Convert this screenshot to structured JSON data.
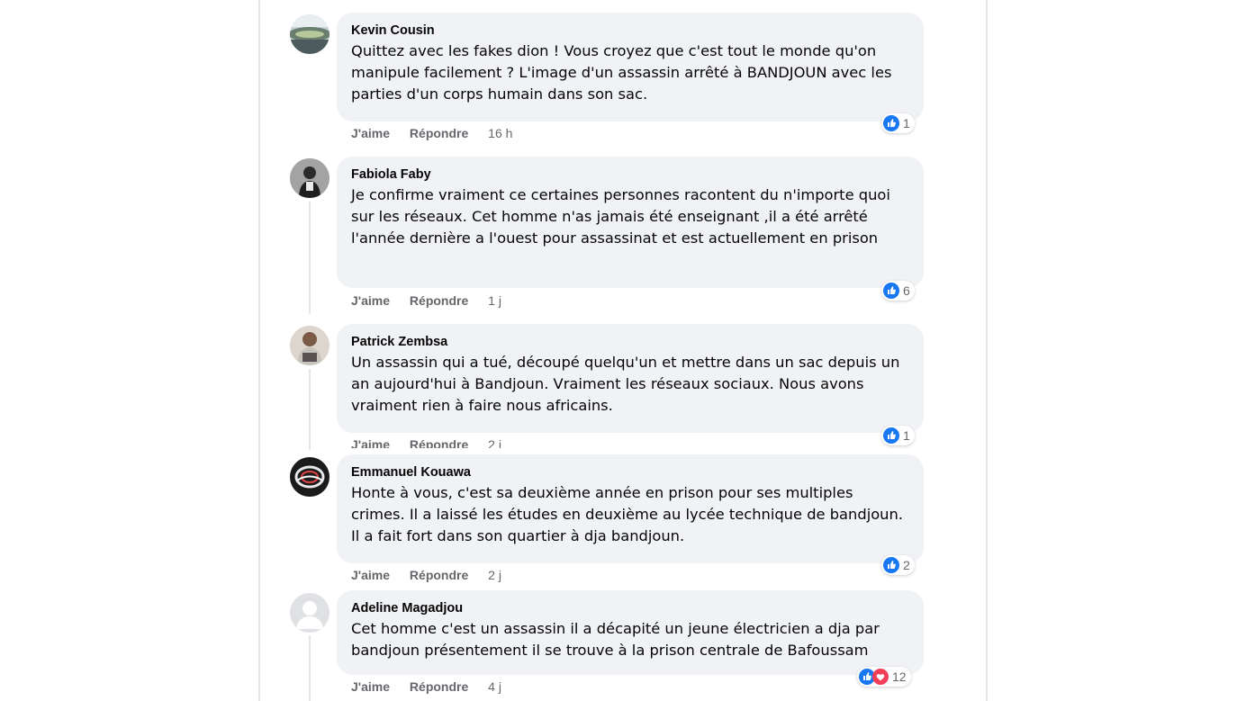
{
  "comments": [
    {
      "author": "Kevin Cousin",
      "text": "Quittez avec les fakes dion ! Vous croyez que c'est tout le monde qu'on manipule facilement ? L'image d'un assassin arrêté à BANDJOUN avec les parties d'un corps humain dans son sac.",
      "like_label": "J'aime",
      "reply_label": "Répondre",
      "time": "16 h",
      "reaction_count": "1",
      "reaction_icons": [
        "like-icon"
      ]
    },
    {
      "author": "Fabiola Faby",
      "text": "Je confirme vraiment ce certaines personnes racontent du n'importe quoi sur les réseaux. Cet homme n'as jamais été enseignant ,il a été arrêté l'année dernière a l'ouest pour assassinat et est actuellement en prison",
      "like_label": "J'aime",
      "reply_label": "Répondre",
      "time": "1 j",
      "reaction_count": "6",
      "reaction_icons": [
        "like-icon"
      ]
    },
    {
      "author": "Patrick Zembsa",
      "text": "Un assassin qui a tué, découpé quelqu'un et mettre dans un sac depuis un an aujourd'hui à Bandjoun. Vraiment les réseaux sociaux. Nous avons vraiment rien à faire nous africains.",
      "like_label": "J'aime",
      "reply_label": "Répondre",
      "time": "2 j",
      "reaction_count": "1",
      "reaction_icons": [
        "like-icon"
      ]
    },
    {
      "author": "Emmanuel Kouawa",
      "text": "Honte à vous, c'est sa deuxième année en prison pour ses multiples crimes. Il a laissé les études en deuxième au lycée technique de bandjoun. Il a fait fort dans son quartier à dja bandjoun.",
      "like_label": "J'aime",
      "reply_label": "Répondre",
      "time": "2 j",
      "reaction_count": "2",
      "reaction_icons": [
        "like-icon"
      ]
    },
    {
      "author": "Adeline Magadjou",
      "text": "Cet homme c'est un assassin il a décapité un jeune électricien a dja par bandjoun présentement il se trouve à la prison centrale de Bafoussam",
      "like_label": "J'aime",
      "reply_label": "Répondre",
      "time": "4 j",
      "reaction_count": "12",
      "reaction_icons": [
        "like-icon",
        "love-icon"
      ]
    }
  ],
  "colors": {
    "bubble": "#f0f2f5",
    "like_blue": "#1877f2",
    "love_red": "#f33e58",
    "meta_gray": "#65676b"
  }
}
